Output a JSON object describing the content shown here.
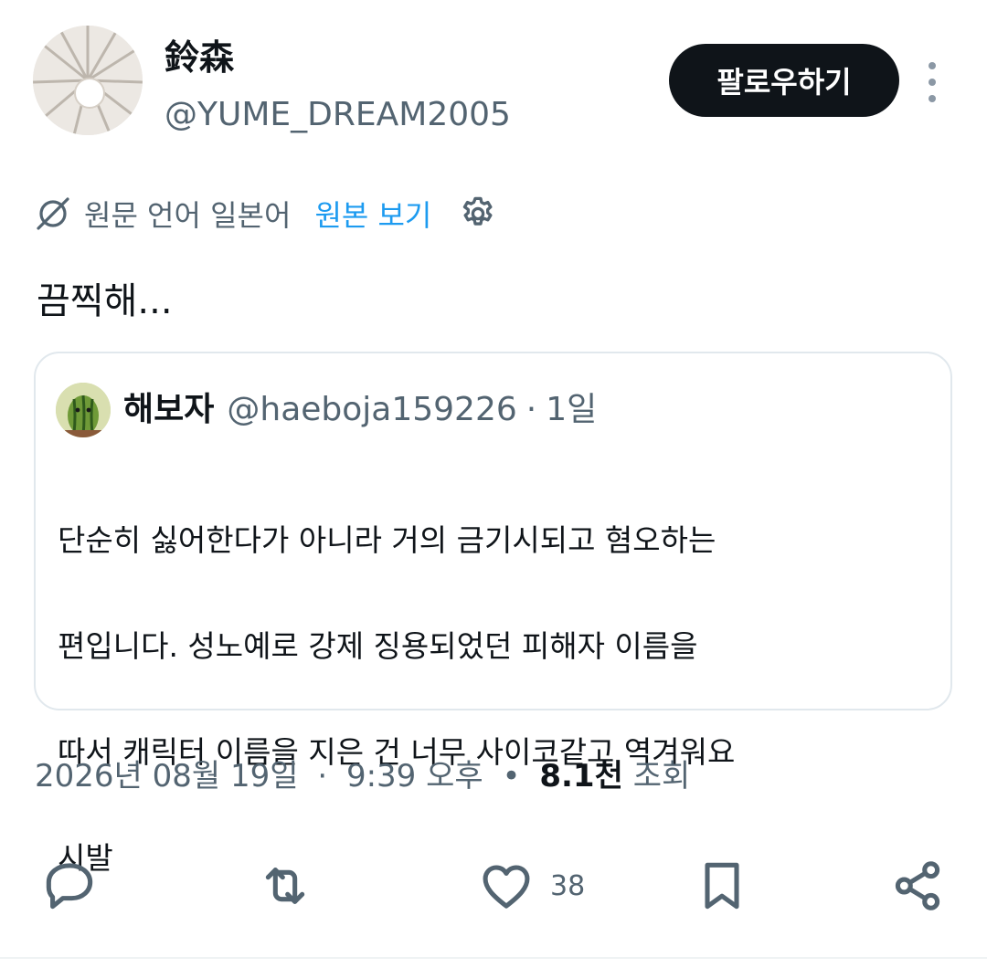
{
  "author": {
    "display_name": "鈴森",
    "handle": "@YUME_DREAM2005",
    "avatar_icon": "paper-fan-avatar"
  },
  "follow_button": {
    "label": "팔로우하기"
  },
  "more_icon": "more-vertical-icon",
  "translation": {
    "label": "원문 언어 일본어",
    "show_original": "원본 보기",
    "icon": "translate-icon",
    "settings_icon": "gear-icon"
  },
  "tweet": {
    "text": "끔찍해..."
  },
  "quote": {
    "name": "해보자",
    "handle": "@haeboja159226",
    "separator": "·",
    "time": "1일",
    "lines": [
      "단순히 싫어한다가 아니라 거의 금기시되고 혐오하는",
      "편입니다. 성노예로 강제 징용되었던 피해자 이름을",
      "따서 캐릭터 이름을 지은 건 너무 사이코같고 역겨워요",
      "시발"
    ]
  },
  "meta": {
    "date": "2026년 08월 19일",
    "separator": "·",
    "time": "9:39 오후",
    "bullet": "•",
    "views_count": "8.1천",
    "views_label": "조회"
  },
  "actions": {
    "reply_icon": "reply-icon",
    "retweet_icon": "retweet-icon",
    "like_icon": "heart-icon",
    "like_count": "38",
    "bookmark_icon": "bookmark-icon",
    "share_icon": "share-icon"
  },
  "colors": {
    "text_primary": "#0f1419",
    "text_secondary": "#536471",
    "link_blue": "#1d9bf0",
    "border": "#e1e8ed",
    "follow_bg": "#0f1419"
  }
}
